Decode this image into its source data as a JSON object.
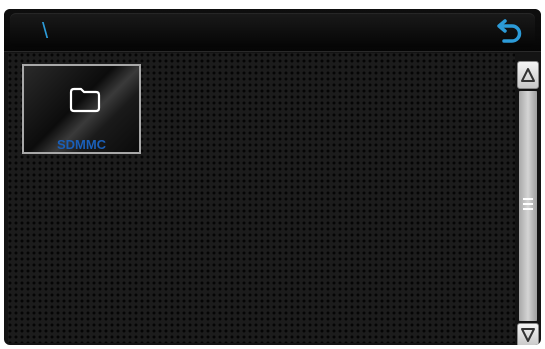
{
  "header": {
    "path": "\\",
    "back_icon": "back-arrow-icon"
  },
  "content": {
    "items": [
      {
        "label": "SDMMC",
        "icon": "folder-icon",
        "type": "folder"
      }
    ]
  },
  "scrollbar": {
    "up_icon": "triangle-up-icon",
    "down_icon": "triangle-down-icon",
    "grip_icon": "grip-lines-icon",
    "position_fraction": 0.0,
    "visible_fraction": 1.0
  },
  "colors": {
    "accent": "#2c9bd8",
    "label_text": "#1a5fb8",
    "background": "#1c1c1c"
  }
}
